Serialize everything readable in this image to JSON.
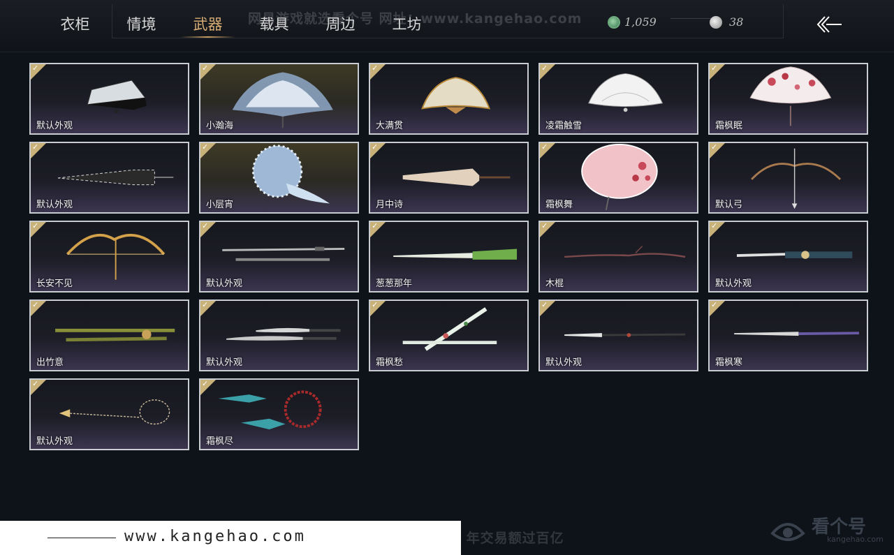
{
  "tabs": [
    {
      "label": "衣柜"
    },
    {
      "label": "情境"
    },
    {
      "label": "武器"
    },
    {
      "label": "载具"
    },
    {
      "label": "周边"
    },
    {
      "label": "工坊"
    }
  ],
  "active_tab": "武器",
  "watermark_top": "网易游戏就选看个号  网址：www.kangehao.com",
  "currency": {
    "jade": "1,059",
    "silver": "38"
  },
  "items": [
    {
      "label": "默认外观",
      "icon": "folding-fan-icon"
    },
    {
      "label": "小瀚海",
      "icon": "feather-fan-icon"
    },
    {
      "label": "大满贯",
      "icon": "gold-fan-icon"
    },
    {
      "label": "凌霜触雪",
      "icon": "lace-fan-icon"
    },
    {
      "label": "霜枫眠",
      "icon": "red-maple-fan-icon"
    },
    {
      "label": "默认外观",
      "icon": "closed-umbrella-icon"
    },
    {
      "label": "小层宵",
      "icon": "spiked-shield-icon"
    },
    {
      "label": "月中诗",
      "icon": "paper-umbrella-icon"
    },
    {
      "label": "霜枫舞",
      "icon": "pink-umbrella-icon"
    },
    {
      "label": "默认弓",
      "icon": "bow-icon"
    },
    {
      "label": "长安不见",
      "icon": "golden-bow-icon"
    },
    {
      "label": "默认外观",
      "icon": "twin-swords-icon"
    },
    {
      "label": "葱葱那年",
      "icon": "scallion-icon"
    },
    {
      "label": "木棍",
      "icon": "wooden-stick-icon"
    },
    {
      "label": "默认外观",
      "icon": "ornate-sword-icon"
    },
    {
      "label": "出竹意",
      "icon": "bamboo-staff-icon"
    },
    {
      "label": "默认外观",
      "icon": "twin-blades-icon"
    },
    {
      "label": "霜枫愁",
      "icon": "painted-swords-icon"
    },
    {
      "label": "默认外观",
      "icon": "spear-icon"
    },
    {
      "label": "霜枫寒",
      "icon": "long-sword-icon"
    },
    {
      "label": "默认外观",
      "icon": "rope-dart-icon"
    },
    {
      "label": "霜枫尽",
      "icon": "beaded-darts-icon"
    }
  ],
  "bottom_banner": {
    "url": "www.kangehao.com"
  },
  "watermark_bottom": "看个号专业网易游戏八年  年交易额过百亿",
  "logo_watermark": {
    "name": "看个号",
    "sub": "kangehao.com"
  }
}
